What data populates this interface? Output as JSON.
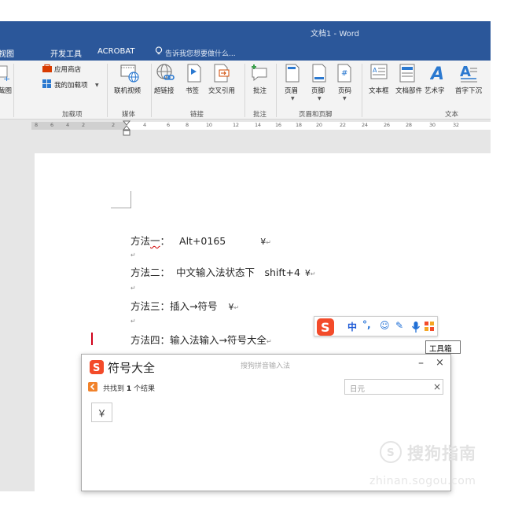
{
  "window": {
    "title": "文档1 - Word"
  },
  "menu": {
    "items": [
      "视图",
      "开发工具",
      "ACROBAT"
    ],
    "tell_me": "告诉我您想要做什么..."
  },
  "ribbon": {
    "partial_left": "截图",
    "addins": {
      "store": "应用商店",
      "my_addins": "我的加载项",
      "group": "加载项"
    },
    "media": {
      "online_video": "联机视频",
      "group": "媒体"
    },
    "links": {
      "hyperlink": "超链接",
      "bookmark": "书签",
      "cross_ref": "交叉引用",
      "group": "链接"
    },
    "comments": {
      "comment": "批注",
      "group": "批注"
    },
    "header_footer": {
      "header": "页眉",
      "footer": "页脚",
      "page_number": "页码",
      "group": "页眉和页脚"
    },
    "text": {
      "textbox": "文本框",
      "quick_parts": "文档部件",
      "wordart": "艺术字",
      "dropcap": "首字下沉",
      "group": "文本"
    }
  },
  "ruler": {
    "ticks": [
      "8",
      "6",
      "4",
      "2",
      "2",
      "4",
      "6",
      "8",
      "10",
      "12",
      "14",
      "16",
      "18",
      "20",
      "22",
      "24",
      "26",
      "28",
      "30",
      "32"
    ]
  },
  "document": {
    "lines": [
      {
        "label": "方法一：",
        "rest": "Alt+0165",
        "symbol": "¥"
      },
      {
        "label": "方法二：",
        "rest": "中文输入法状态下　shift+4",
        "symbol": "¥"
      },
      {
        "label": "方法三：",
        "rest": "插入→符号",
        "symbol": "¥"
      },
      {
        "label": "方法四：",
        "rest": "输入法输入→符号大全",
        "symbol": ""
      }
    ],
    "paragraph_mark": "↵"
  },
  "ime": {
    "buttons": [
      "中",
      "°,",
      "☺",
      "✎",
      "🎤",
      "▦"
    ],
    "tooltip": "工具箱"
  },
  "symbol_panel": {
    "title": "符号大全",
    "subtitle": "搜狗拼音输入法",
    "found_prefix": "共找到",
    "found_count": "1",
    "found_suffix": "个结果",
    "search_value": "日元",
    "result": "￥",
    "minimize": "–",
    "close": "×"
  },
  "watermark": {
    "text": "搜狗指南",
    "url": "zhinan.sogou.com"
  },
  "colors": {
    "word_blue": "#2b579a",
    "sogou_orange": "#f34b2a",
    "cursor_red": "#d0021b"
  }
}
